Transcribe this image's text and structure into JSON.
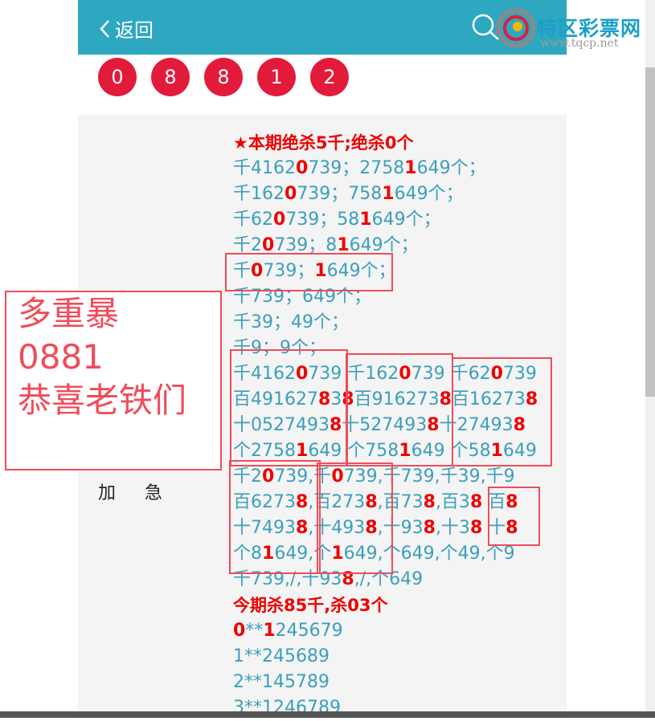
{
  "header": {
    "back_label": "返回",
    "logo_name": "特区彩票网",
    "logo_url": "www.tqcp.net",
    "bg_color": "#2ea7c1"
  },
  "balls": [
    "0",
    "8",
    "8",
    "1",
    "2"
  ],
  "annotation": {
    "line1": "多重暴",
    "line2": "0881",
    "line3": "恭喜老铁们"
  },
  "urgent_label": "加急",
  "content": {
    "lines": [
      [
        {
          "t": "★本期绝杀5千",
          "r": 1
        },
        {
          "t": ";",
          "r": 0
        },
        {
          "t": "绝杀0个",
          "r": 1
        }
      ],
      [
        {
          "t": "千4162",
          "r": 0
        },
        {
          "t": "0",
          "r": 1
        },
        {
          "t": "739；2758",
          "r": 0
        },
        {
          "t": "1",
          "r": 1
        },
        {
          "t": "649个；",
          "r": 0
        }
      ],
      [
        {
          "t": "千162",
          "r": 0
        },
        {
          "t": "0",
          "r": 1
        },
        {
          "t": "739；758",
          "r": 0
        },
        {
          "t": "1",
          "r": 1
        },
        {
          "t": "649个；",
          "r": 0
        }
      ],
      [
        {
          "t": "千62",
          "r": 0
        },
        {
          "t": "0",
          "r": 1
        },
        {
          "t": "739；58",
          "r": 0
        },
        {
          "t": "1",
          "r": 1
        },
        {
          "t": "649个；",
          "r": 0
        }
      ],
      [
        {
          "t": "千2",
          "r": 0
        },
        {
          "t": "0",
          "r": 1
        },
        {
          "t": "739；8",
          "r": 0
        },
        {
          "t": "1",
          "r": 1
        },
        {
          "t": "649个；",
          "r": 0
        }
      ],
      [
        {
          "t": "千",
          "r": 0
        },
        {
          "t": "0",
          "r": 1
        },
        {
          "t": "739；",
          "r": 0
        },
        {
          "t": "1",
          "r": 1
        },
        {
          "t": "649个；",
          "r": 0
        }
      ],
      [
        {
          "t": "千739；649个；",
          "r": 0
        }
      ],
      [
        {
          "t": "千39；49个；",
          "r": 0
        }
      ],
      [
        {
          "t": "千9；9个；",
          "r": 0
        }
      ],
      [
        {
          "t": "千4162",
          "r": 0
        },
        {
          "t": "0",
          "r": 1
        },
        {
          "t": "739 千162",
          "r": 0
        },
        {
          "t": "0",
          "r": 1
        },
        {
          "t": "739 千62",
          "r": 0
        },
        {
          "t": "0",
          "r": 1
        },
        {
          "t": "739",
          "r": 0
        }
      ],
      [
        {
          "t": "百491627",
          "r": 0
        },
        {
          "t": "8",
          "r": 1
        },
        {
          "t": "3",
          "r": 0
        },
        {
          "t": "8",
          "r": 1
        },
        {
          "t": "百91627",
          "r": 0
        },
        {
          "t": "3",
          "r": 0
        },
        {
          "t": "8",
          "r": 1
        },
        {
          "t": "百16273",
          "r": 0
        },
        {
          "t": "8",
          "r": 1
        }
      ],
      [
        {
          "t": "十052749",
          "r": 0
        },
        {
          "t": "3",
          "r": 0
        },
        {
          "t": "8",
          "r": 1
        },
        {
          "t": "十527493",
          "r": 0
        },
        {
          "t": "8",
          "r": 1
        },
        {
          "t": "十27493",
          "r": 0
        },
        {
          "t": "8",
          "r": 1
        }
      ],
      [
        {
          "t": "个2758",
          "r": 0
        },
        {
          "t": "1",
          "r": 1
        },
        {
          "t": "649 个758",
          "r": 0
        },
        {
          "t": "1",
          "r": 1
        },
        {
          "t": "649 个58",
          "r": 0
        },
        {
          "t": "1",
          "r": 1
        },
        {
          "t": "649",
          "r": 0
        }
      ],
      [
        {
          "t": "千2",
          "r": 0
        },
        {
          "t": "0",
          "r": 1
        },
        {
          "t": "739,千",
          "r": 0
        },
        {
          "t": "0",
          "r": 1
        },
        {
          "t": "739,千739,千39,千9",
          "r": 0
        }
      ],
      [
        {
          "t": "百6273",
          "r": 0
        },
        {
          "t": "8",
          "r": 1
        },
        {
          "t": ",百273",
          "r": 0
        },
        {
          "t": "8",
          "r": 1
        },
        {
          "t": ",百73",
          "r": 0
        },
        {
          "t": "8",
          "r": 1
        },
        {
          "t": ",百3",
          "r": 0
        },
        {
          "t": "8",
          "r": 1
        },
        {
          "t": " 百",
          "r": 0
        },
        {
          "t": "8",
          "r": 1
        }
      ],
      [
        {
          "t": "十7493",
          "r": 0
        },
        {
          "t": "8",
          "r": 1
        },
        {
          "t": ",十493",
          "r": 0
        },
        {
          "t": "8",
          "r": 1
        },
        {
          "t": ",十93",
          "r": 0
        },
        {
          "t": "8",
          "r": 1
        },
        {
          "t": ",十3",
          "r": 0
        },
        {
          "t": "8",
          "r": 1
        },
        {
          "t": " 十",
          "r": 0
        },
        {
          "t": "8",
          "r": 1
        }
      ],
      [
        {
          "t": "个8",
          "r": 0
        },
        {
          "t": "1",
          "r": 1
        },
        {
          "t": "649,个",
          "r": 0
        },
        {
          "t": "1",
          "r": 1
        },
        {
          "t": "649,个649,个49,个9",
          "r": 0
        }
      ],
      [
        {
          "t": "千739,/,十93",
          "r": 0
        },
        {
          "t": "8",
          "r": 1
        },
        {
          "t": ",/,个649",
          "r": 0
        }
      ],
      [
        {
          "t": "今期杀85千",
          "r": 1
        },
        {
          "t": ",",
          "r": 0
        },
        {
          "t": "杀03个",
          "r": 1
        }
      ],
      [
        {
          "t": "0",
          "r": 1
        },
        {
          "t": "**",
          "r": 0
        },
        {
          "t": "1",
          "r": 1
        },
        {
          "t": "245679",
          "r": 0
        }
      ],
      [
        {
          "t": "1**245689",
          "r": 0
        }
      ],
      [
        {
          "t": "2**145789",
          "r": 0
        }
      ],
      [
        {
          "t": "3**1246789",
          "r": 0
        }
      ]
    ]
  }
}
